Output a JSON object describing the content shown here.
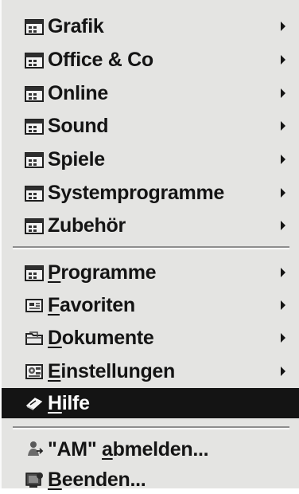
{
  "menu": {
    "groups": [
      {
        "label": "Grafik",
        "icon": "program-group-icon",
        "submenu": true
      },
      {
        "label": "Office & Co",
        "icon": "program-group-icon",
        "submenu": true
      },
      {
        "label": "Online",
        "icon": "program-group-icon",
        "submenu": true
      },
      {
        "label": "Sound",
        "icon": "program-group-icon",
        "submenu": true
      },
      {
        "label": "Spiele",
        "icon": "program-group-icon",
        "submenu": true
      },
      {
        "label": "Systemprogramme",
        "icon": "program-group-icon",
        "submenu": true
      },
      {
        "label": "Zubehör",
        "icon": "program-group-icon",
        "submenu": true
      }
    ],
    "main": [
      {
        "mnemonic": "P",
        "rest": "rogramme",
        "icon": "programs-icon",
        "submenu": true
      },
      {
        "mnemonic": "F",
        "rest": "avoriten",
        "icon": "favorites-icon",
        "submenu": true
      },
      {
        "mnemonic": "D",
        "rest": "okumente",
        "icon": "documents-icon",
        "submenu": true
      },
      {
        "mnemonic": "E",
        "rest": "instellungen",
        "icon": "settings-icon",
        "submenu": true
      },
      {
        "mnemonic": "H",
        "rest": "ilfe",
        "icon": "help-icon",
        "submenu": false,
        "highlighted": true
      }
    ],
    "logoff": {
      "prefix": "\"AM\" ",
      "mnemonic": "a",
      "rest": "bmelden...",
      "icon": "logoff-icon"
    },
    "shutdown": {
      "mnemonic": "B",
      "rest": "eenden...",
      "icon": "shutdown-icon"
    }
  },
  "colors": {
    "menu_bg": "#e4e4e2",
    "highlight_bg": "#141414",
    "folder": "#2e2e2e"
  }
}
